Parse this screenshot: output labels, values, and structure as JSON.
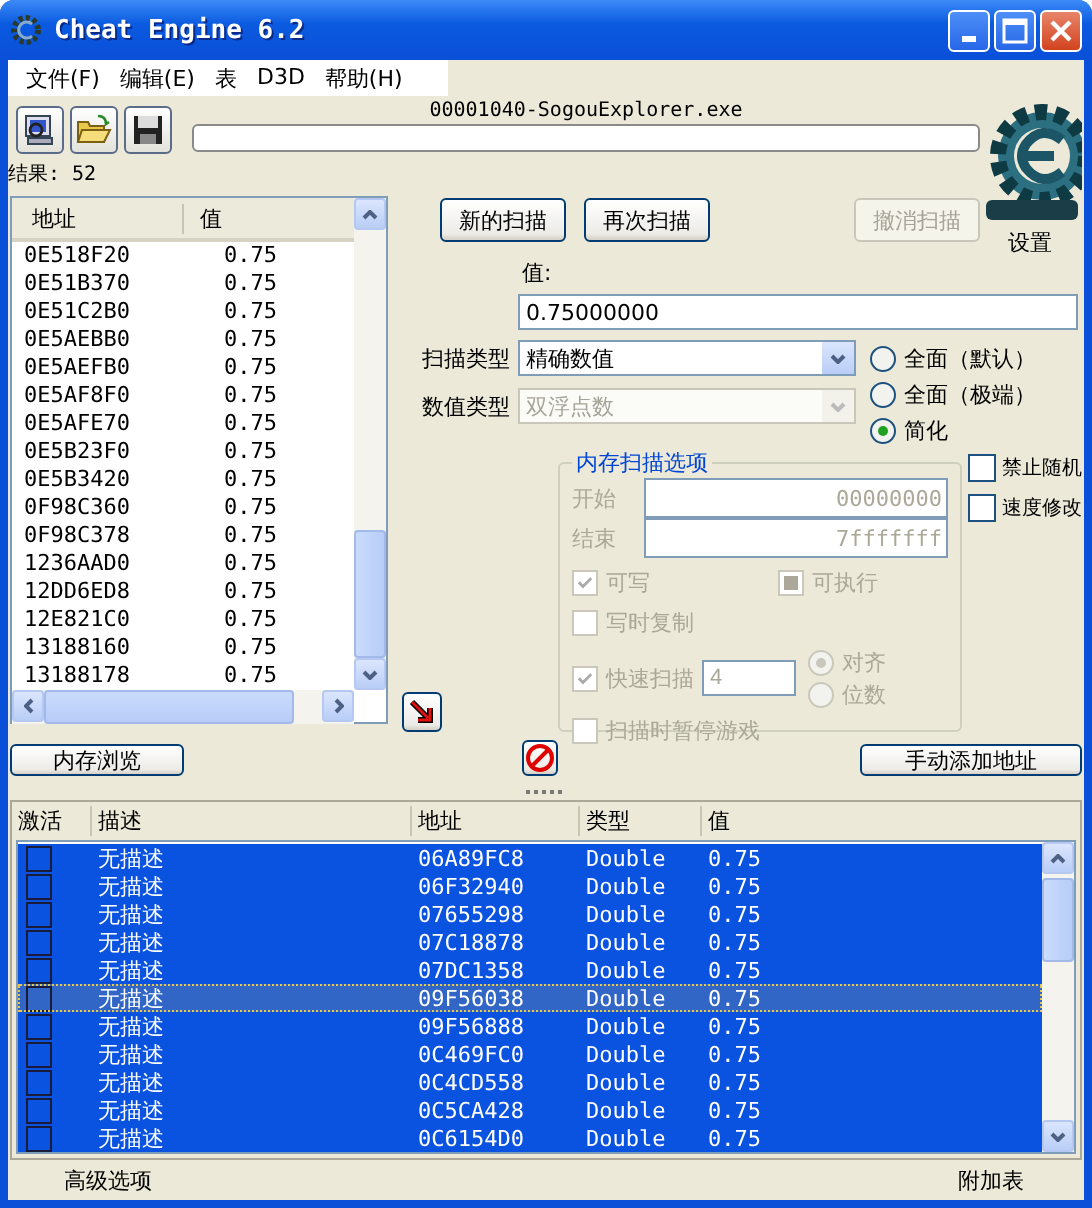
{
  "window": {
    "title": "Cheat Engine 6.2"
  },
  "menu": [
    {
      "label": "文件(F)"
    },
    {
      "label": "编辑(E)"
    },
    {
      "label": "表"
    },
    {
      "label": "D3D"
    },
    {
      "label": "帮助(H)"
    }
  ],
  "process": {
    "name": "00001040-SogouExplorer.exe",
    "level": 0
  },
  "logo_label": "设置",
  "results": "结果: 52",
  "found_list": {
    "columns": [
      "地址",
      "值"
    ],
    "rows": [
      {
        "address": "0E518F20",
        "value": "0.75"
      },
      {
        "address": "0E51B370",
        "value": "0.75"
      },
      {
        "address": "0E51C2B0",
        "value": "0.75"
      },
      {
        "address": "0E5AEBB0",
        "value": "0.75"
      },
      {
        "address": "0E5AEFB0",
        "value": "0.75"
      },
      {
        "address": "0E5AF8F0",
        "value": "0.75"
      },
      {
        "address": "0E5AFE70",
        "value": "0.75"
      },
      {
        "address": "0E5B23F0",
        "value": "0.75"
      },
      {
        "address": "0E5B3420",
        "value": "0.75"
      },
      {
        "address": "0F98C360",
        "value": "0.75"
      },
      {
        "address": "0F98C378",
        "value": "0.75"
      },
      {
        "address": "1236AAD0",
        "value": "0.75"
      },
      {
        "address": "12DD6ED8",
        "value": "0.75"
      },
      {
        "address": "12E821C0",
        "value": "0.75"
      },
      {
        "address": "13188160",
        "value": "0.75"
      },
      {
        "address": "13188178",
        "value": "0.75"
      }
    ]
  },
  "scan_buttons": [
    {
      "label": "新的扫描",
      "disabled": false
    },
    {
      "label": "再次扫描",
      "disabled": false
    },
    {
      "label": "撤消扫描",
      "disabled": true
    }
  ],
  "value_field": {
    "label": "值:",
    "value": "0.75000000"
  },
  "selects": [
    {
      "label": "扫描类型",
      "value": "精确数值",
      "disabled": false
    },
    {
      "label": "数值类型",
      "value": "双浮点数",
      "disabled": true
    }
  ],
  "scan_modes": [
    {
      "label": "全面（默认）",
      "selected": false
    },
    {
      "label": "全面（极端）",
      "selected": false
    },
    {
      "label": "简化",
      "selected": true
    }
  ],
  "memory_options": {
    "title": "内存扫描选项",
    "disabled": true,
    "start_label": "开始",
    "start": "00000000",
    "end_label": "结束",
    "end": "7fffffff",
    "protection": [
      {
        "label": "可写",
        "checked": true
      },
      {
        "label": "可执行",
        "indeterminate": true
      },
      {
        "label": "写时复制",
        "checked": false
      }
    ],
    "fast_scan": {
      "label": "快速扫描",
      "checked": true,
      "value": "4"
    },
    "alignment": [
      {
        "label": "对齐",
        "selected": true
      },
      {
        "label": "位数",
        "selected": false
      }
    ],
    "pause": {
      "label": "扫描时暂停游戏",
      "checked": false
    }
  },
  "side_options": [
    {
      "label": "禁止随机",
      "checked": false
    },
    {
      "label": "速度修改",
      "checked": false
    }
  ],
  "memory_view_button": "内存浏览",
  "add_address_button": "手动添加地址",
  "address_list": {
    "columns": [
      "激活",
      "描述",
      "地址",
      "类型",
      "值"
    ],
    "rows": [
      {
        "active": false,
        "description": "无描述",
        "address": "06A89FC8",
        "type": "Double",
        "value": "0.75",
        "selected": true,
        "focused": false
      },
      {
        "active": false,
        "description": "无描述",
        "address": "06F32940",
        "type": "Double",
        "value": "0.75",
        "selected": true,
        "focused": false
      },
      {
        "active": false,
        "description": "无描述",
        "address": "07655298",
        "type": "Double",
        "value": "0.75",
        "selected": true,
        "focused": false
      },
      {
        "active": false,
        "description": "无描述",
        "address": "07C18878",
        "type": "Double",
        "value": "0.75",
        "selected": true,
        "focused": false
      },
      {
        "active": false,
        "description": "无描述",
        "address": "07DC1358",
        "type": "Double",
        "value": "0.75",
        "selected": true,
        "focused": false
      },
      {
        "active": false,
        "description": "无描述",
        "address": "09F56038",
        "type": "Double",
        "value": "0.75",
        "selected": true,
        "focused": true
      },
      {
        "active": false,
        "description": "无描述",
        "address": "09F56888",
        "type": "Double",
        "value": "0.75",
        "selected": true,
        "focused": false
      },
      {
        "active": false,
        "description": "无描述",
        "address": "0C469FC0",
        "type": "Double",
        "value": "0.75",
        "selected": true,
        "focused": false
      },
      {
        "active": false,
        "description": "无描述",
        "address": "0C4CD558",
        "type": "Double",
        "value": "0.75",
        "selected": true,
        "focused": false
      },
      {
        "active": false,
        "description": "无描述",
        "address": "0C5CA428",
        "type": "Double",
        "value": "0.75",
        "selected": true,
        "focused": false
      },
      {
        "active": false,
        "description": "无描述",
        "address": "0C6154D0",
        "type": "Double",
        "value": "0.75",
        "selected": true,
        "focused": false
      }
    ]
  },
  "status_bar": {
    "left": "高级选项",
    "right": "附加表"
  }
}
